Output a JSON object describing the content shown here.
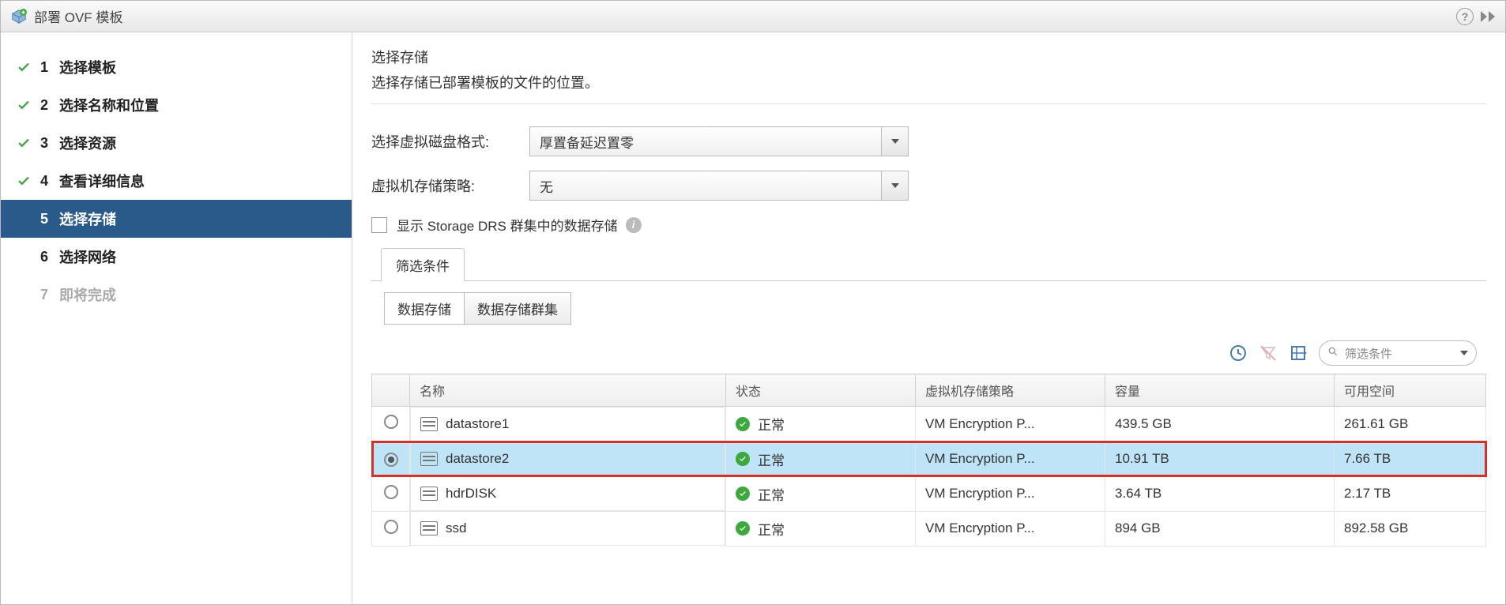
{
  "titlebar": {
    "title": "部署 OVF 模板"
  },
  "sidebar": {
    "steps": [
      {
        "num": "1",
        "label": "选择模板",
        "state": "done"
      },
      {
        "num": "2",
        "label": "选择名称和位置",
        "state": "done"
      },
      {
        "num": "3",
        "label": "选择资源",
        "state": "done"
      },
      {
        "num": "4",
        "label": "查看详细信息",
        "state": "done"
      },
      {
        "num": "5",
        "label": "选择存储",
        "state": "active"
      },
      {
        "num": "6",
        "label": "选择网络",
        "state": "future"
      },
      {
        "num": "7",
        "label": "即将完成",
        "state": "disabled"
      }
    ]
  },
  "main": {
    "heading": "选择存储",
    "subheading": "选择存储已部署模板的文件的位置。",
    "disk_format_label": "选择虚拟磁盘格式:",
    "disk_format_value": "厚置备延迟置零",
    "storage_policy_label": "虚拟机存储策略:",
    "storage_policy_value": "无",
    "drs_checkbox_label": "显示 Storage DRS 群集中的数据存储",
    "tab_filter": "筛选条件",
    "btn_datastores": "数据存储",
    "btn_ds_clusters": "数据存储群集",
    "filter_placeholder": "筛选条件",
    "table": {
      "headers": {
        "name": "名称",
        "status": "状态",
        "policy": "虚拟机存储策略",
        "capacity": "容量",
        "free": "可用空间"
      },
      "rows": [
        {
          "name": "datastore1",
          "status": "正常",
          "policy": "VM Encryption P...",
          "capacity": "439.5  GB",
          "free": "261.61  GB",
          "selected": false
        },
        {
          "name": "datastore2",
          "status": "正常",
          "policy": "VM Encryption P...",
          "capacity": "10.91  TB",
          "free": "7.66  TB",
          "selected": true,
          "highlight": true
        },
        {
          "name": "hdrDISK",
          "status": "正常",
          "policy": "VM Encryption P...",
          "capacity": "3.64  TB",
          "free": "2.17  TB",
          "selected": false
        },
        {
          "name": "ssd",
          "status": "正常",
          "policy": "VM Encryption P...",
          "capacity": "894  GB",
          "free": "892.58  GB",
          "selected": false
        }
      ]
    }
  }
}
